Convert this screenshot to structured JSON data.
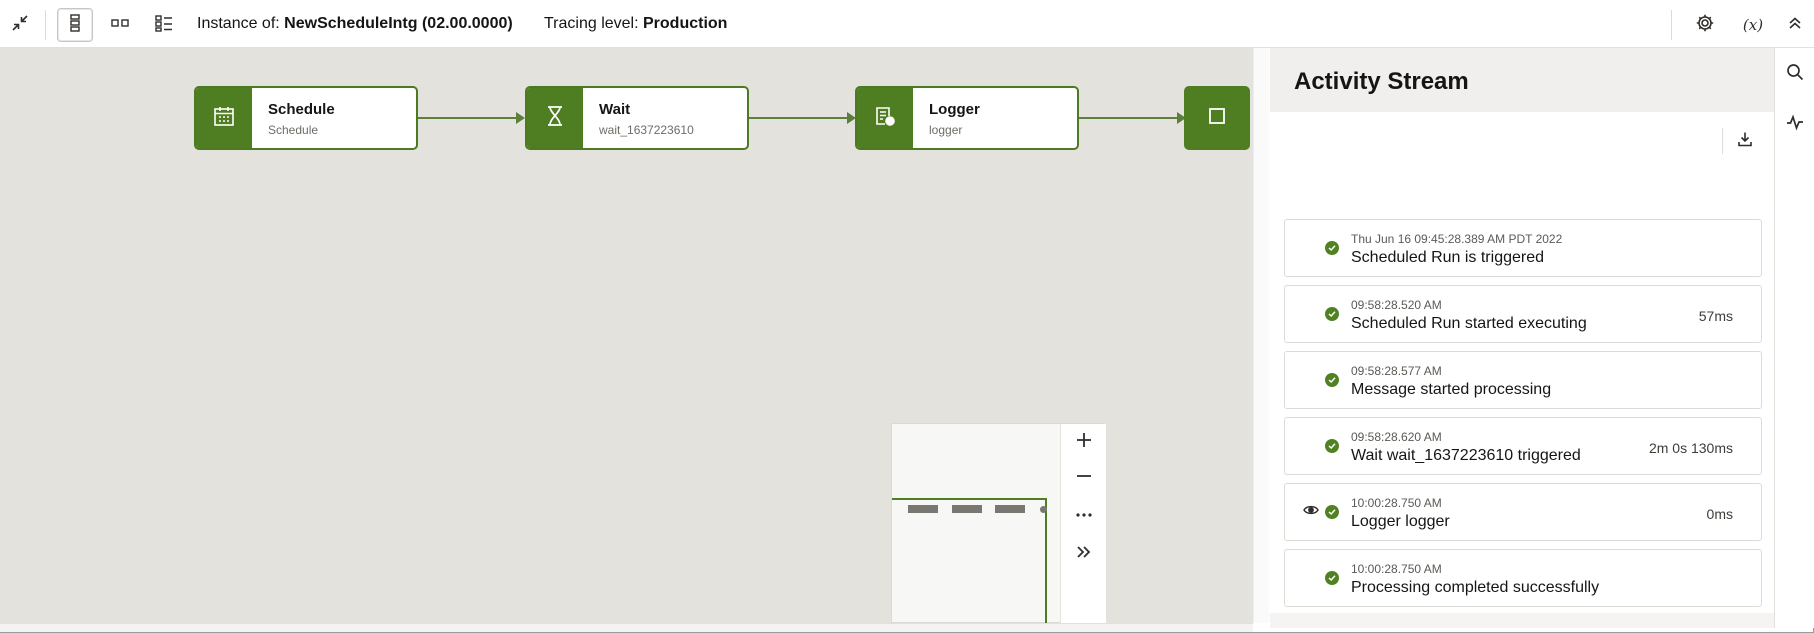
{
  "toolbar": {
    "instance_prefix": "Instance of: ",
    "instance_name": "NewScheduleIntg (02.00.0000)",
    "tracing_prefix": "Tracing level: ",
    "tracing_level": "Production",
    "variable_label": "(x)",
    "icons": [
      "collapse-icon",
      "vertical-layout-icon",
      "horizontal-layout-icon",
      "list-layout-icon",
      "gear-icon",
      "variables-icon",
      "chevron-up-icon"
    ]
  },
  "flow": {
    "nodes": [
      {
        "title": "Schedule",
        "subtitle": "Schedule",
        "icon": "calendar-icon"
      },
      {
        "title": "Wait",
        "subtitle": "wait_1637223610",
        "icon": "hourglass-icon"
      },
      {
        "title": "Logger",
        "subtitle": "logger",
        "icon": "logger-icon"
      }
    ],
    "end_icon": "stop-icon",
    "accent_color": "#4e7d22"
  },
  "minimap": {
    "controls": [
      "zoom-in-icon",
      "zoom-out-icon",
      "more-icon",
      "expand-icon"
    ]
  },
  "activity": {
    "title": "Activity Stream",
    "download_icon": "download-icon",
    "status_color": "#508223",
    "entries": [
      {
        "time": "Thu Jun 16 09:45:28.389 AM PDT 2022",
        "message": "Scheduled Run is triggered",
        "duration": ""
      },
      {
        "time": "09:58:28.520 AM",
        "message": "Scheduled Run started executing",
        "duration": "57ms"
      },
      {
        "time": "09:58:28.577 AM",
        "message": "Message started processing",
        "duration": ""
      },
      {
        "time": "09:58:28.620 AM",
        "message": "Wait wait_1637223610 triggered",
        "duration": "2m 0s 130ms"
      },
      {
        "time": "10:00:28.750 AM",
        "message": "Logger logger",
        "duration": "0ms",
        "has_view": true
      },
      {
        "time": "10:00:28.750 AM",
        "message": "Processing completed successfully",
        "duration": ""
      }
    ]
  },
  "rail": {
    "icons": [
      "search-icon",
      "activity-icon"
    ]
  }
}
